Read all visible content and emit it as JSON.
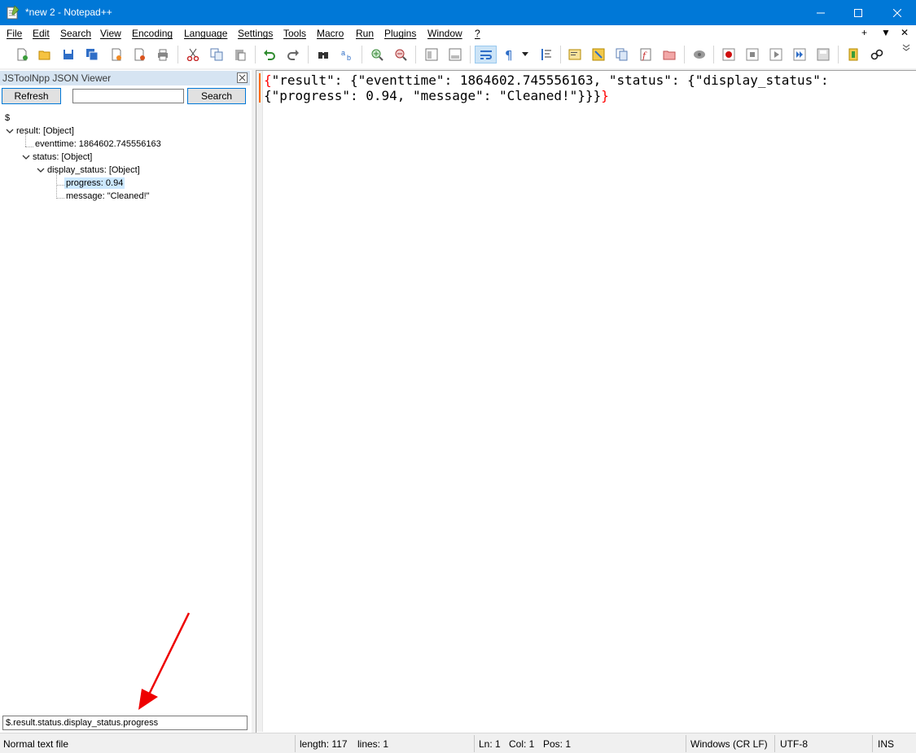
{
  "window": {
    "title": "*new 2 - Notepad++"
  },
  "menu": {
    "items": [
      "File",
      "Edit",
      "Search",
      "View",
      "Encoding",
      "Language",
      "Settings",
      "Tools",
      "Macro",
      "Run",
      "Plugins",
      "Window",
      "?"
    ],
    "right_controls": [
      "+",
      "▼",
      "✕"
    ]
  },
  "toolbar": {
    "icons": [
      "new-file-icon",
      "open-file-icon",
      "save-icon",
      "save-all-icon",
      "close-icon",
      "close-all-icon",
      "print-icon",
      "cut-icon",
      "copy-icon",
      "paste-icon",
      "undo-icon",
      "redo-icon",
      "find-icon",
      "replace-icon",
      "zoom-in-icon",
      "zoom-out-icon",
      "sync-vertical-icon",
      "sync-horizontal-icon",
      "word-wrap-icon",
      "show-all-chars-icon",
      "dropdown-icon",
      "indent-guide-icon",
      "user-defined-lang-icon",
      "doc-map-icon",
      "doc-list-icon",
      "function-list-icon",
      "folder-workspace-icon",
      "monitoring-icon",
      "record-macro-icon",
      "stop-macro-icon",
      "play-macro-icon",
      "run-macro-multiple-icon",
      "save-macro-icon",
      "plugin-icon",
      "link-icon"
    ],
    "active": "word-wrap-icon"
  },
  "panel": {
    "title": "JSToolNpp JSON Viewer",
    "refresh_label": "Refresh",
    "search_label": "Search",
    "search_value": "",
    "tree": {
      "root": "$",
      "result": "result: [Object]",
      "eventtime": "eventtime: 1864602.745556163",
      "status": "status: [Object]",
      "display_status": "display_status: [Object]",
      "progress": "progress: 0.94",
      "message": "message: \"Cleaned!\""
    },
    "path": "$.result.status.display_status.progress"
  },
  "editor": {
    "line1_open": "{",
    "line1_text": "\"result\": {\"eventtime\": 1864602.745556163, \"status\": {\"display_status\":",
    "line2_text": "{\"progress\": 0.94, \"message\": \"Cleaned!\"}}}",
    "line2_close": "}"
  },
  "status": {
    "file_type": "Normal text file",
    "length": "length: 117",
    "lines": "lines: 1",
    "ln": "Ln: 1",
    "col": "Col: 1",
    "pos": "Pos: 1",
    "eol": "Windows (CR LF)",
    "encoding": "UTF-8",
    "mode": "INS"
  },
  "colors": {
    "titlebar": "#0078d7",
    "brace": "#ff0000",
    "annotation_arrow": "#ee0000",
    "selection": "#cce8ff"
  }
}
